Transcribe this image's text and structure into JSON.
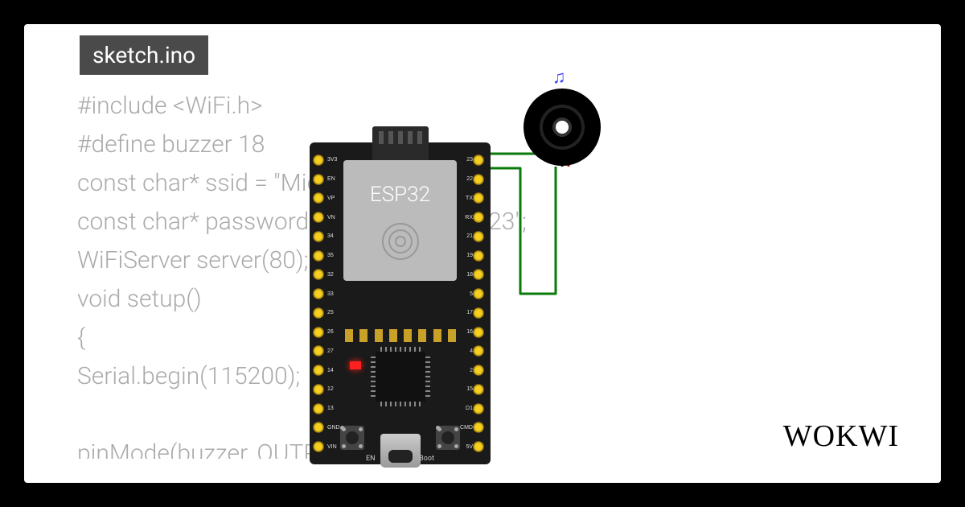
{
  "tab": {
    "filename": "sketch.ino"
  },
  "code": {
    "text": "#include <WiFi.h>\n#define buzzer 18\nconst char* ssid = \"Mido\";\nconst char* password = \"1234567891523\";\nWiFiServer server(80);\nvoid setup()\n{\nSerial.begin(115200);\n\npinMode(buzzer, OUTPUT); //*edited*"
  },
  "board": {
    "chip_label": "ESP32",
    "btn_en": "EN",
    "btn_boot": "Boot"
  },
  "buzzer": {
    "icon": "♫"
  },
  "branding": {
    "logo": "WOKWI"
  },
  "pins_left": [
    "3V3",
    "EN",
    "VP",
    "VN",
    "34",
    "35",
    "32",
    "33",
    "25",
    "26",
    "27",
    "14",
    "12",
    "13",
    "GND",
    "VIN"
  ],
  "pins_right": [
    "23",
    "22",
    "TX",
    "RX",
    "21",
    "19",
    "18",
    "5",
    "17",
    "16",
    "4",
    "2",
    "15",
    "D1",
    "CMD",
    "5V"
  ],
  "wires": {
    "signal_color": "#0a7a0a",
    "power_color": "#d01010"
  }
}
